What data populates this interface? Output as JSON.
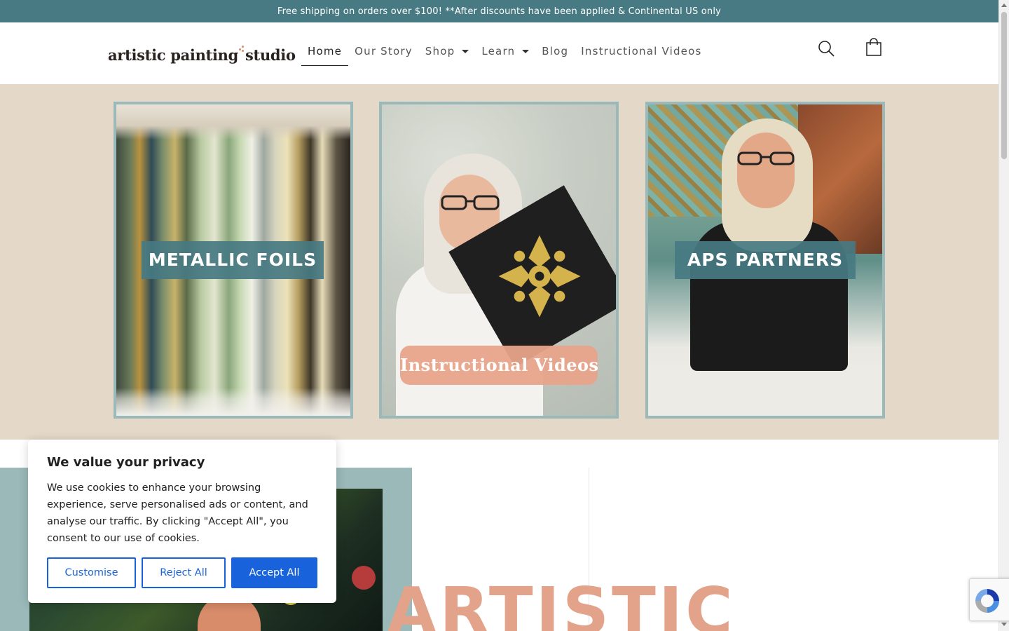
{
  "announcement": "Free shipping on orders over $100! **After discounts have been applied & Continental US only",
  "header": {
    "logo_text_left": "artistic painting",
    "logo_text_right": "studio",
    "nav": [
      {
        "label": "Home",
        "active": true,
        "dropdown": false
      },
      {
        "label": "Our Story",
        "active": false,
        "dropdown": false
      },
      {
        "label": "Shop",
        "active": false,
        "dropdown": true
      },
      {
        "label": "Learn",
        "active": false,
        "dropdown": true
      },
      {
        "label": "Blog",
        "active": false,
        "dropdown": false
      },
      {
        "label": "Instructional Videos",
        "active": false,
        "dropdown": false
      }
    ],
    "icons": [
      "search-icon",
      "cart-icon"
    ]
  },
  "hero": {
    "cards": [
      {
        "label": "METALLIC FOILS"
      },
      {
        "label": "Instructional Videos"
      },
      {
        "label": "APS PARTNERS"
      }
    ]
  },
  "lower": {
    "big_word": "ARTISTIC"
  },
  "cookie": {
    "title": "We value your privacy",
    "text": "We use cookies to enhance your browsing experience, serve personalised ads or content, and analyse our traffic. By clicking \"Accept All\", you consent to our use of cookies.",
    "customise_label": "Customise",
    "reject_label": "Reject All",
    "accept_label": "Accept All"
  },
  "colors": {
    "announcement_bg": "#477a82",
    "hero_bg": "#e4d8c8",
    "card_border": "#9ab9b8",
    "accent_pink": "#e3a38a",
    "button_blue": "#1863dc"
  }
}
